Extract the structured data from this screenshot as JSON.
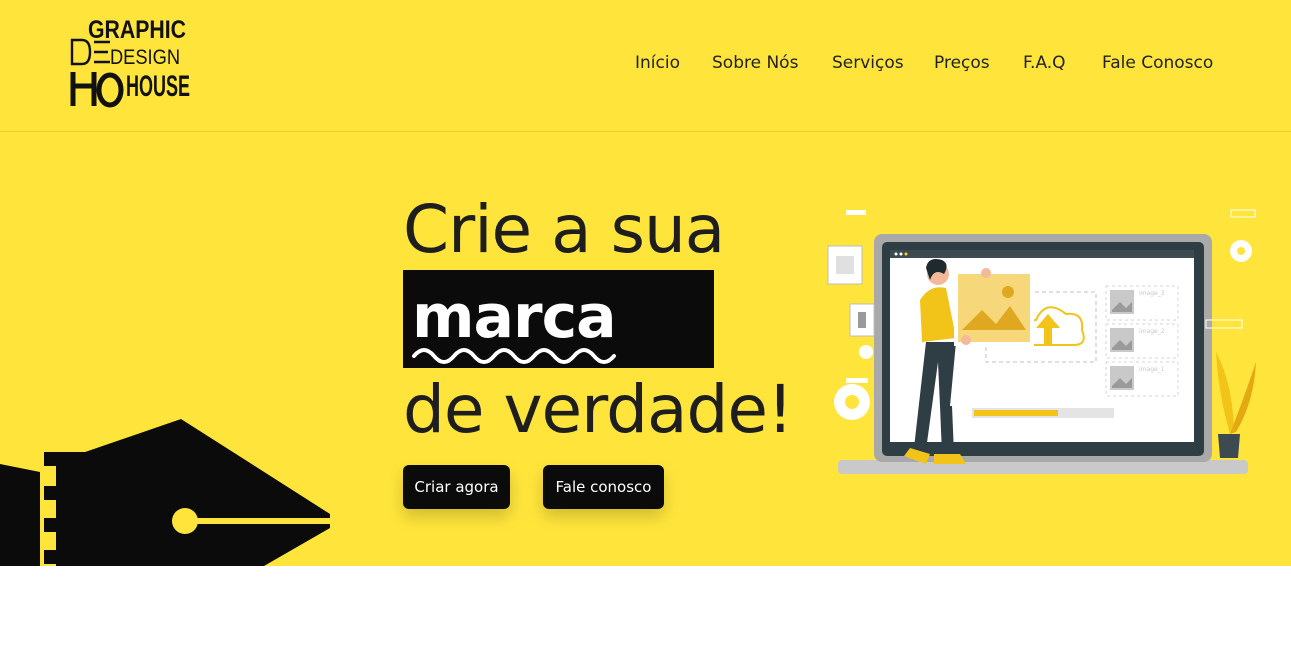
{
  "brand": {
    "logo_alt": "Graphic Design House",
    "logo_line1": "GRAPHIC",
    "logo_line2": "DESIGN",
    "logo_line3": "HOUSE"
  },
  "nav": {
    "items": [
      "Início",
      "Sobre Nós",
      "Serviços",
      "Preços",
      "F.A.Q",
      "Fale Conosco"
    ]
  },
  "hero": {
    "line1": "Crie a sua",
    "highlight": "marca",
    "line3": "de verdade!",
    "primary_cta": "Criar agora",
    "secondary_cta": "Fale conosco"
  },
  "illustration": {
    "file_labels": [
      "image_3",
      "image_2",
      "image_1"
    ]
  },
  "colors": {
    "accent": "#ffe53b",
    "dark": "#0b0b0b",
    "text": "#1e1e1e"
  }
}
